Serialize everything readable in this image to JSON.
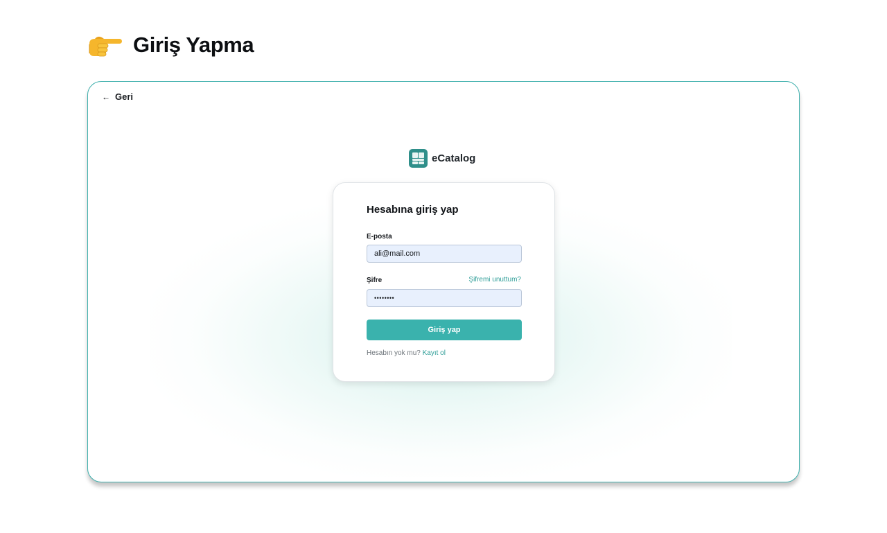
{
  "page": {
    "title": "Giriş Yapma",
    "emoji": "👉"
  },
  "nav": {
    "back_arrow": "←",
    "back_label": "Geri"
  },
  "brand": {
    "name": "eCatalog",
    "logo_icon": "grid-logo-icon",
    "color": "#2f8f8a"
  },
  "login": {
    "title": "Hesabına giriş yap",
    "email": {
      "label": "E-posta",
      "value": "ali@mail.com"
    },
    "password": {
      "label": "Şifre",
      "value": "••••••••",
      "forgot_label": "Şifremi unuttum?"
    },
    "submit_label": "Giriş yap",
    "signup": {
      "prompt": "Hesabın yok mu?",
      "link_label": "Kayıt ol"
    }
  },
  "colors": {
    "accent": "#3ab2ad",
    "frame_border": "#3fb0ad",
    "input_bg": "#e8f0fd"
  }
}
